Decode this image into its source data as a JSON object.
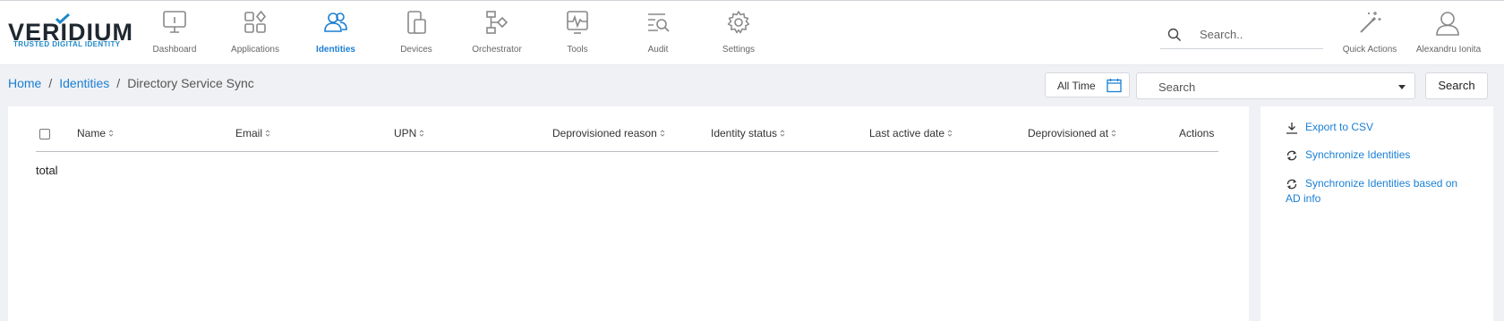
{
  "brand": {
    "name": "VERIDIUM",
    "tagline": "TRUSTED DIGITAL IDENTITY",
    "accent": "#1a7fd4"
  },
  "nav": {
    "items": [
      {
        "label": "Dashboard",
        "icon": "monitor-icon",
        "active": false
      },
      {
        "label": "Applications",
        "icon": "applications-icon",
        "active": false
      },
      {
        "label": "Identities",
        "icon": "users-icon",
        "active": true
      },
      {
        "label": "Devices",
        "icon": "devices-icon",
        "active": false
      },
      {
        "label": "Orchestrator",
        "icon": "orchestrator-icon",
        "active": false
      },
      {
        "label": "Tools",
        "icon": "tools-icon",
        "active": false
      },
      {
        "label": "Audit",
        "icon": "audit-icon",
        "active": false
      },
      {
        "label": "Settings",
        "icon": "gear-icon",
        "active": false
      }
    ]
  },
  "header": {
    "search_placeholder": "Search..",
    "quick_actions_label": "Quick Actions",
    "user_name": "Alexandru Ionita"
  },
  "breadcrumb": {
    "items": [
      "Home",
      "Identities",
      "Directory Service Sync"
    ]
  },
  "filters": {
    "time_label": "All Time",
    "select_value": "Search",
    "search_button": "Search"
  },
  "table": {
    "columns": [
      "Name",
      "Email",
      "UPN",
      "Deprovisioned reason",
      "Identity status",
      "Last active date",
      "Deprovisioned at",
      "Actions"
    ],
    "rows": [],
    "total_label": "total"
  },
  "side_actions": [
    {
      "label": "Export to CSV",
      "icon": "download-icon"
    },
    {
      "label": "Synchronize Identities",
      "icon": "sync-icon"
    },
    {
      "label": "Synchronize Identities based on AD info",
      "icon": "sync-icon"
    }
  ]
}
